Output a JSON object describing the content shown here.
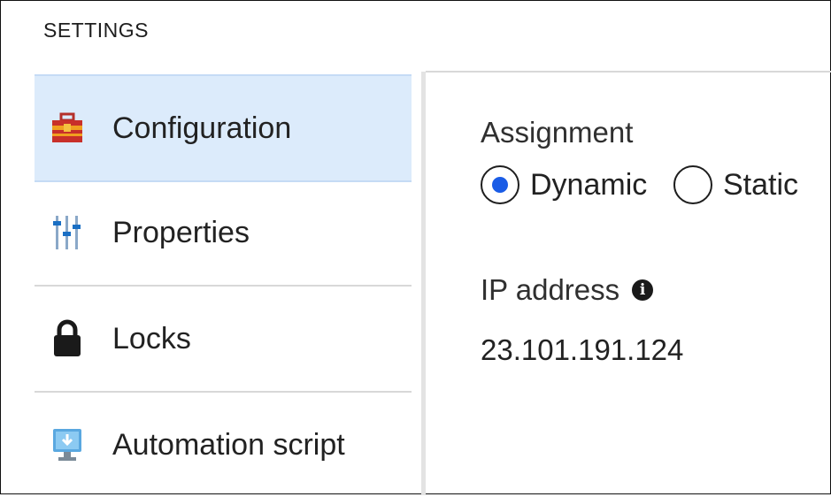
{
  "settings_header": "SETTINGS",
  "sidebar": {
    "items": [
      {
        "label": "Configuration",
        "icon": "toolbox-icon",
        "active": true
      },
      {
        "label": "Properties",
        "icon": "sliders-icon",
        "active": false
      },
      {
        "label": "Locks",
        "icon": "lock-icon",
        "active": false
      },
      {
        "label": "Automation script",
        "icon": "monitor-download-icon",
        "active": false
      }
    ]
  },
  "content": {
    "assignment_label": "Assignment",
    "options": [
      {
        "label": "Dynamic",
        "selected": true
      },
      {
        "label": "Static",
        "selected": false
      }
    ],
    "ip_label": "IP address",
    "ip_info_icon": "info-icon",
    "ip_value": "23.101.191.124"
  },
  "colors": {
    "active_background": "#dcebfb",
    "radio_selected": "#1a5ce6"
  }
}
